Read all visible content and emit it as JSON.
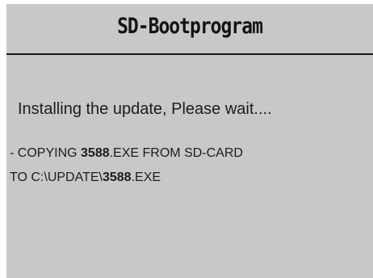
{
  "header": {
    "title": "SD-Bootprogram"
  },
  "status": {
    "message": "Installing the update, Please wait...."
  },
  "copy": {
    "line1_prefix": "- COPYING ",
    "line1_number": "3588",
    "line1_suffix": ".EXE FROM SD-CARD",
    "line2_prefix": "TO C:\\UPDATE\\",
    "line2_number": "3588",
    "line2_suffix": ".EXE"
  },
  "colors": {
    "screen_background": "#c8c8c8",
    "text": "#1c1c1c",
    "rule": "#1a1a1a"
  }
}
